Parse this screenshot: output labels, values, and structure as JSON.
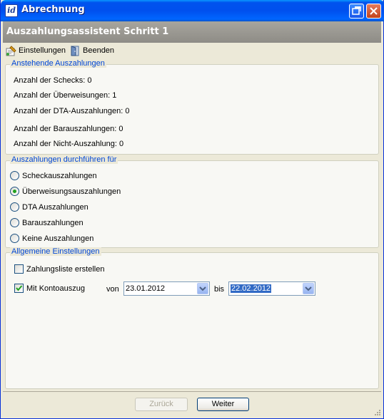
{
  "window": {
    "title": "Abrechnung",
    "icon": "id-app-icon"
  },
  "header": {
    "title": "Auszahlungsassistent Schritt 1"
  },
  "toolbar": {
    "settings_label": "Einstellungen",
    "exit_label": "Beenden"
  },
  "pending": {
    "legend": "Anstehende Auszahlungen",
    "lines": [
      "Anzahl der Schecks: 0",
      "Anzahl der Überweisungen: 1",
      "Anzahl der DTA-Auszahlungen: 0",
      "Anzahl der Barauszahlungen: 0",
      "Anzahl der Nicht-Auszahlung: 0"
    ]
  },
  "payout": {
    "legend": "Auszahlungen durchführen für",
    "options": [
      "Scheckauszahlungen",
      "Überweisungsauszahlungen",
      "DTA Auszahlungen",
      "Barauszahlungen",
      "Keine Auszahlungen"
    ],
    "selected_index": 1
  },
  "general": {
    "legend": "Allgemeine Einstellungen",
    "payment_list_label": "Zahlungsliste erstellen",
    "payment_list_checked": false,
    "statement_label": "Mit Kontoauszug",
    "statement_checked": true,
    "from_label": "von",
    "from_value": "23.01.2012",
    "to_label": "bis",
    "to_value": "22.02.2012"
  },
  "footer": {
    "back_label": "Zurück",
    "back_enabled": false,
    "next_label": "Weiter"
  },
  "colors": {
    "legend": "#0046d5",
    "titlebar": "#0053ee",
    "accent_check": "#21a121"
  }
}
